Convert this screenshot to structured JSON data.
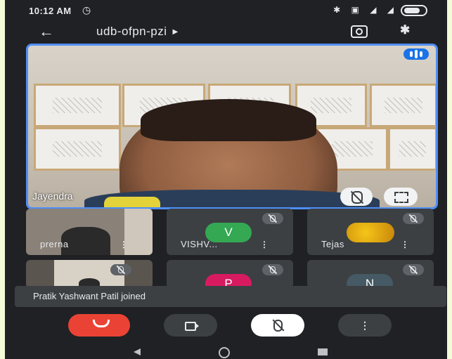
{
  "status_bar": {
    "time": "10:12 AM",
    "alarm_icon": "alarm-icon",
    "system_icons": "bluetooth, volte, signal, signal, battery"
  },
  "top_bar": {
    "meeting_code": "udb-ofpn-pzi",
    "back_icon": "back-arrow-icon",
    "flip_icon": "switch-camera-icon",
    "audio_icon": "bluetooth-icon"
  },
  "main_video": {
    "participant_name": "Jayendra"
  },
  "tiles": [
    {
      "name": "prerna",
      "type": "video"
    },
    {
      "name": "VISHV...",
      "type": "avatar",
      "initial": "V",
      "color": "#34a853"
    },
    {
      "name": "Tejas",
      "type": "photo"
    },
    {
      "name": "",
      "type": "video"
    },
    {
      "name": "",
      "type": "avatar",
      "initial": "P",
      "color": "#d81b60"
    },
    {
      "name": "",
      "type": "avatar",
      "initial": "N",
      "color": "#455a64"
    }
  ],
  "toast": {
    "message": "Pratik Yashwant Patil joined"
  },
  "controls": {
    "end_call_icon": "end-call-icon",
    "camera_icon": "camera-icon",
    "mic_icon": "mic-off-icon",
    "more_icon": "more-vertical-icon"
  },
  "colors": {
    "background": "#202124",
    "tile": "#3c4043",
    "accent": "#4f8ef7",
    "end_call": "#ea4335"
  }
}
